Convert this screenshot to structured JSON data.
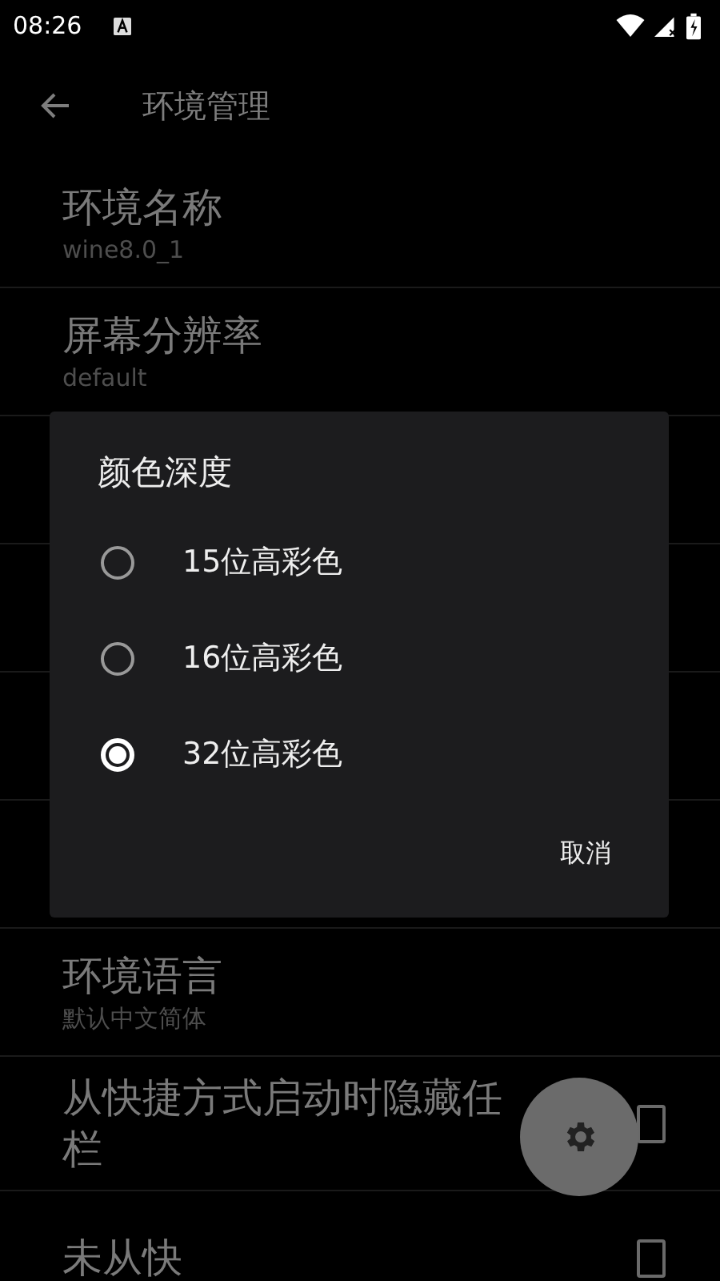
{
  "status_bar": {
    "time": "08:26"
  },
  "app_bar": {
    "title": "环境管理"
  },
  "settings": [
    {
      "kind": "text",
      "title": [
        "环境名称"
      ],
      "summary": "wine8.0_1"
    },
    {
      "kind": "text",
      "title": [
        "屏幕分辨率"
      ],
      "summary": "default"
    },
    {
      "kind": "hidden"
    },
    {
      "kind": "hidden"
    },
    {
      "kind": "hidden"
    },
    {
      "kind": "hidden"
    },
    {
      "kind": "text",
      "title": [
        "环境语言"
      ],
      "summary": "默认中文简体"
    },
    {
      "kind": "checkbox",
      "title": [
        "从快捷方式启动时隐藏任",
        "栏"
      ],
      "checked": false
    },
    {
      "kind": "checkbox",
      "title": [
        "未从快"
      ],
      "checked": false
    }
  ],
  "dialog": {
    "title": "颜色深度",
    "options": [
      {
        "label": "15位高彩色",
        "selected": false
      },
      {
        "label": "16位高彩色",
        "selected": false
      },
      {
        "label": "32位高彩色",
        "selected": true
      }
    ],
    "buttons": [
      "取消"
    ]
  }
}
